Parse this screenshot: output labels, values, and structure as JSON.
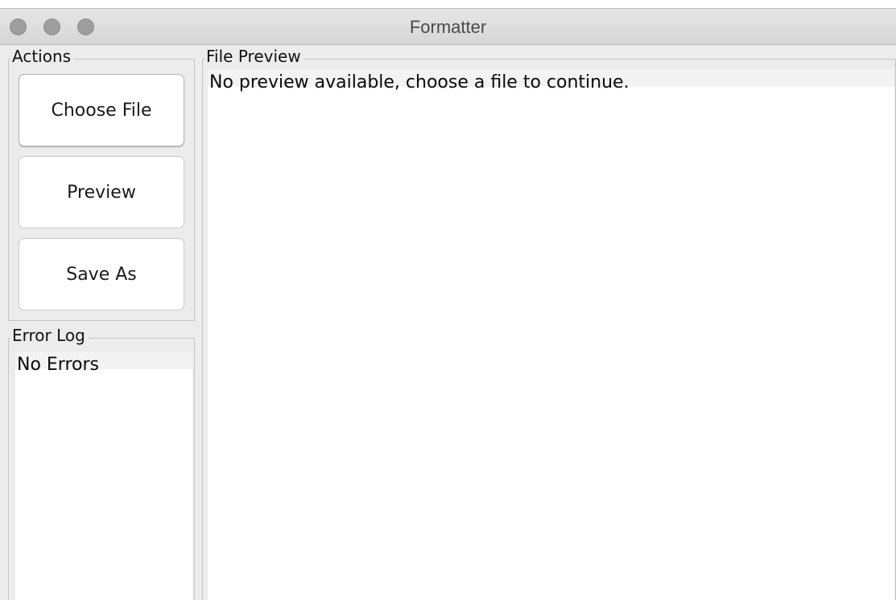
{
  "window": {
    "title": "Formatter"
  },
  "actions": {
    "label": "Actions",
    "choose_file": "Choose File",
    "preview": "Preview",
    "save_as": "Save As"
  },
  "error_log": {
    "label": "Error Log",
    "text": "No Errors"
  },
  "file_preview": {
    "label": "File Preview",
    "text": "No preview available, choose a file to continue."
  }
}
